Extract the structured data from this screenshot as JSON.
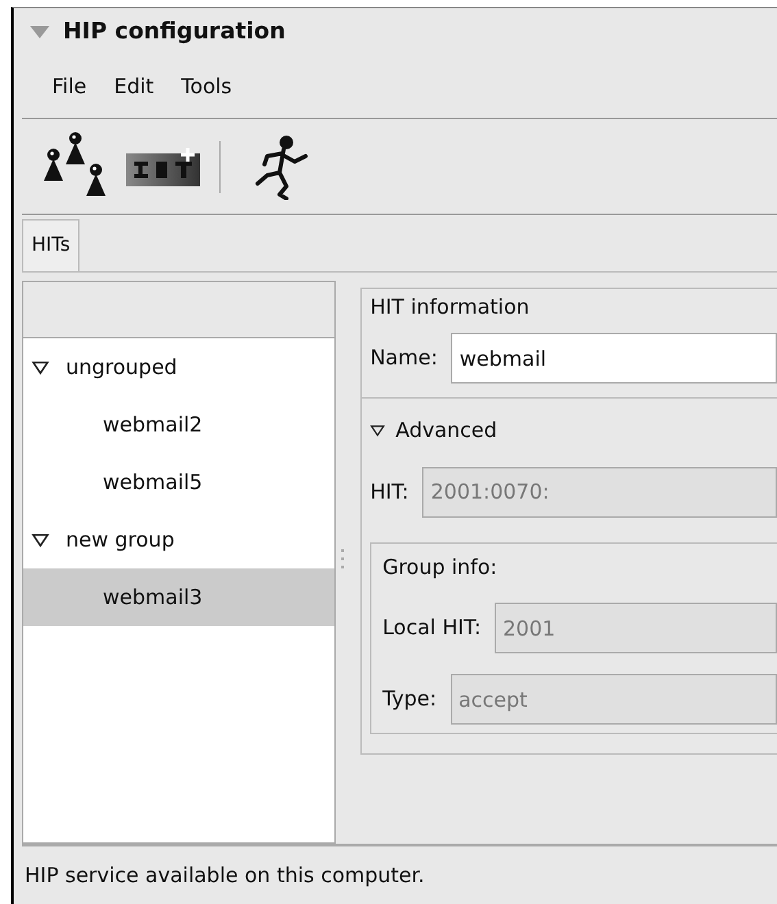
{
  "window": {
    "title": "HIP configuration"
  },
  "menu": [
    "File",
    "Edit",
    "Tools"
  ],
  "toolbar": [
    {
      "kind": "people"
    },
    {
      "kind": "new-hit"
    },
    {
      "kind": "separator"
    },
    {
      "kind": "runner"
    }
  ],
  "tabs": [
    {
      "label": "HITs",
      "selected": true
    }
  ],
  "tree": {
    "items": [
      {
        "label": "ungrouped",
        "expanded": true,
        "selected": false,
        "children": [
          {
            "label": "webmail2",
            "selected": false
          },
          {
            "label": "webmail5",
            "selected": false
          }
        ]
      },
      {
        "label": "new group",
        "expanded": true,
        "selected": false,
        "children": [
          {
            "label": "webmail3",
            "selected": true
          }
        ]
      }
    ]
  },
  "hit_information": {
    "title": "HIT information",
    "name": {
      "label": "Name:",
      "value": "webmail"
    }
  },
  "advanced": {
    "label": "Advanced",
    "expanded": true,
    "hit": {
      "label": "HIT:",
      "value": "2001:0070:",
      "disabled": true
    },
    "group_info": {
      "title": "Group info:",
      "local_hit": {
        "label": "Local HIT:",
        "value": "2001",
        "disabled": true
      },
      "type": {
        "label": "Type:",
        "value": "accept",
        "disabled": true
      }
    }
  },
  "status_bar": "HIP service available on this computer."
}
